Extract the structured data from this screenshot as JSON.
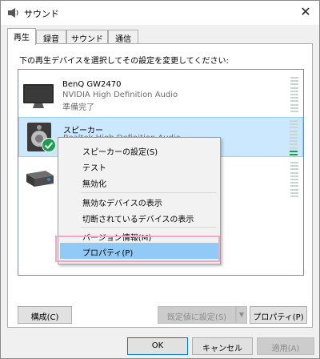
{
  "window": {
    "title": "サウンド",
    "close_glyph": "✕"
  },
  "tabs": [
    {
      "label": "再生",
      "active": true
    },
    {
      "label": "録音",
      "active": false
    },
    {
      "label": "サウンド",
      "active": false
    },
    {
      "label": "通信",
      "active": false
    }
  ],
  "instruction": "下の再生デバイスを選択してその設定を変更してください:",
  "devices": [
    {
      "name": "BenQ GW2470",
      "driver": "NVIDIA High Definition Audio",
      "status": "準備完了",
      "icon": "monitor-icon"
    },
    {
      "name": "スピーカー",
      "driver": "Realtek High Definition Audio",
      "status": "",
      "icon": "speaker-icon",
      "selected": true,
      "default_badge": "check-icon",
      "level": 0.15
    },
    {
      "name": "",
      "driver": "",
      "status": "",
      "icon": "receiver-icon"
    }
  ],
  "context_menu": {
    "items": [
      {
        "label": "スピーカーの設定(S)"
      },
      {
        "label": "テスト"
      },
      {
        "label": "無効化"
      },
      {
        "label": "無効なデバイスの表示"
      },
      {
        "label": "切断されているデバイスの表示"
      },
      {
        "label": "バージョン情報(M)"
      },
      {
        "label": "プロパティ(P)",
        "highlighted": true
      }
    ]
  },
  "buttons": {
    "configure": "構成(C)",
    "set_default": "既定値に設定(S)",
    "properties": "プロパティ(P)",
    "ok": "OK",
    "cancel": "キャンセル",
    "apply": "適用(A)"
  },
  "colors": {
    "selection": "#cce8ff",
    "menu_highlight": "#91c9f7",
    "highlight_frame": "#f0a7c5",
    "meter_active": "#1e9e4e"
  }
}
